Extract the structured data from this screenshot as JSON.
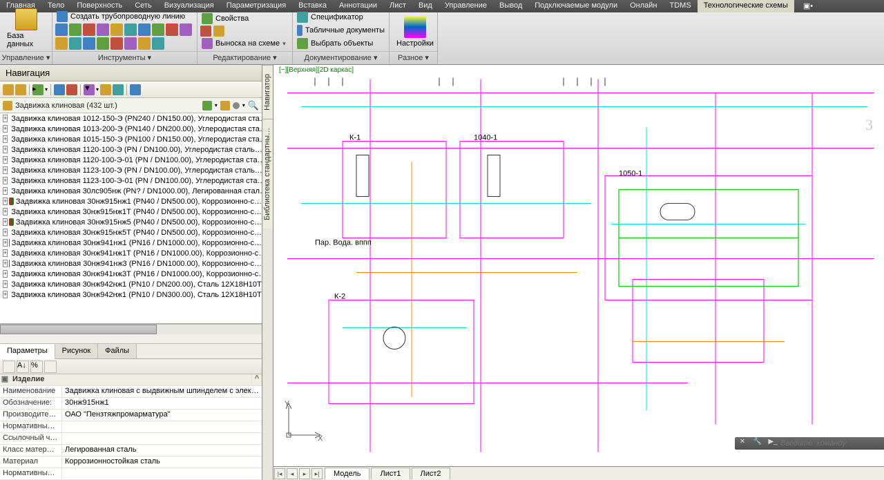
{
  "menu": [
    "Главная",
    "Тело",
    "Поверхность",
    "Сеть",
    "Визуализация",
    "Параметризация",
    "Вставка",
    "Аннотации",
    "Лист",
    "Вид",
    "Управление",
    "Вывод",
    "Подключаемые модули",
    "Онлайн",
    "TDMS",
    "Технологические схемы"
  ],
  "ribbon": {
    "g0": {
      "label": "База данных",
      "btn": "База данных"
    },
    "g1": {
      "label": "Управление ▾"
    },
    "g2": {
      "label": "Инструменты ▾",
      "items": [
        "Создать трубопроводную линию"
      ]
    },
    "g3": {
      "label": "Редактирование ▾",
      "items": [
        "Свойства",
        "Выноска на схеме"
      ]
    },
    "g4": {
      "label": "Документирование ▾",
      "items": [
        "Спецификатор",
        "Табличные документы",
        "Выбрать объекты"
      ]
    },
    "g5": {
      "label": "Разное ▾",
      "btn": "Настройки"
    }
  },
  "nav": {
    "title": "Навигация",
    "path": "Задвижка клиновая (432 шт.)",
    "items": [
      "Задвижка клиновая 1012-150-Э (PN240 / DN150.00), Углеродистая ста…",
      "Задвижка клиновая 1013-200-Э (PN140 / DN200.00), Углеродистая ста…",
      "Задвижка клиновая 1015-150-Э (PN100 / DN150.00), Углеродистая ста…",
      "Задвижка клиновая 1120-100-Э (PN  / DN100.00), Углеродистая сталь…",
      "Задвижка клиновая 1120-100-Э-01 (PN  / DN100.00), Углеродистая ста…",
      "Задвижка клиновая 1123-100-Э (PN  / DN100.00), Углеродистая сталь…",
      "Задвижка клиновая 1123-100-Э-01 (PN  / DN100.00), Углеродистая ста…",
      "Задвижка клиновая 30лс905нж (PN? / DN1000.00), Легированная стал…",
      "Задвижка клиновая 30нж915нж1 (PN40 / DN500.00), Коррозионно-с…",
      "Задвижка клиновая 30нж915нж1Т (PN40 / DN500.00), Коррозионно-с…",
      "Задвижка клиновая 30нж915нж5 (PN40 / DN500.00), Коррозионно-с…",
      "Задвижка клиновая 30нж915нж5Т (PN40 / DN500.00), Коррозионно-с…",
      "Задвижка клиновая 30нж941нж1 (PN16 / DN1000.00), Коррозионно-с…",
      "Задвижка клиновая 30нж941нж1Т (PN16 / DN1000.00), Коррозионно-с…",
      "Задвижка клиновая 30нж941нж3 (PN16 / DN1000.00), Коррозионно-с…",
      "Задвижка клиновая 30нж941нж3Т (PN16 / DN1000.00), Коррозионно-с…",
      "Задвижка клиновая 30нж942нж1 (PN10 / DN200.00), Сталь 12Х18Н10Т…",
      "Задвижка клиновая 30нж942нж1 (PN10 / DN300.00), Сталь 12Х18Н10Т…"
    ]
  },
  "tabs": [
    "Параметры",
    "Рисунок",
    "Файлы"
  ],
  "props": {
    "header": "Изделие",
    "rows": [
      {
        "k": "Наименование",
        "v": "Задвижка клиновая с выдвижным шпинделем с электроп…"
      },
      {
        "k": "Обозначение:",
        "v": "30нж915нж1"
      },
      {
        "k": "Производите…",
        "v": "ОАО \"Пензтяжпромарматура\""
      },
      {
        "k": "Нормативны…",
        "v": ""
      },
      {
        "k": "Ссылочный ч…",
        "v": ""
      },
      {
        "k": "Класс матер…",
        "v": "Легированная сталь"
      },
      {
        "k": "Материал",
        "v": "Коррозионностойкая сталь"
      },
      {
        "k": "Нормативны…",
        "v": ""
      }
    ]
  },
  "vtabs": [
    "Навигатор",
    "Библиотека стандартны…"
  ],
  "canvas": {
    "label": "[−][Верхняя][2D каркас]",
    "big3": "3"
  },
  "cmd": {
    "placeholder": "Введите  команду"
  },
  "sheets": [
    "Модель",
    "Лист1",
    "Лист2"
  ]
}
